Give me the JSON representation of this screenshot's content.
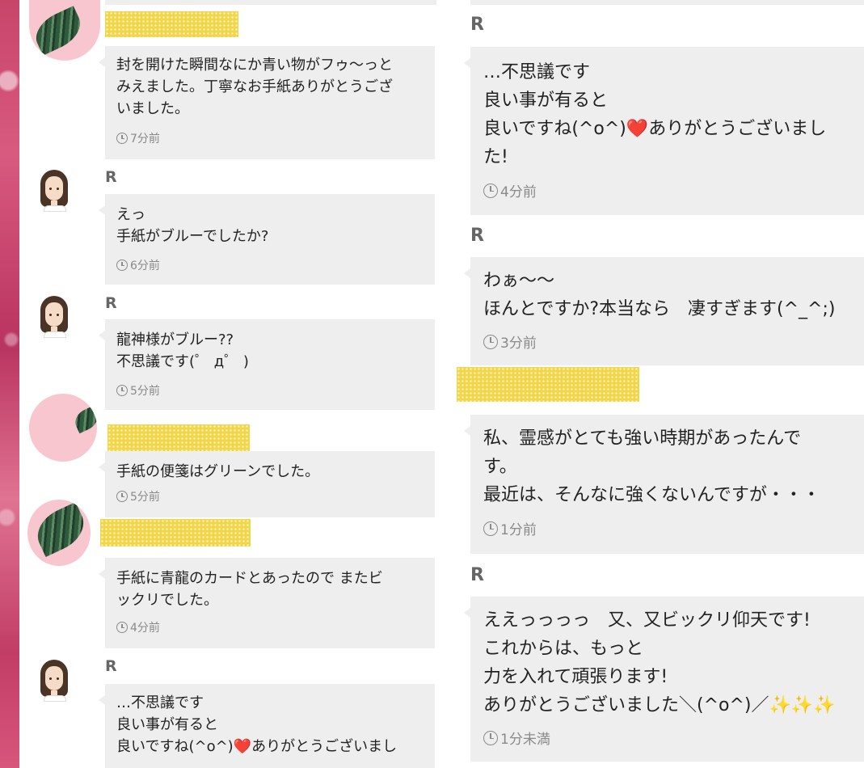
{
  "left_messages": [
    {
      "sender": "",
      "text": "封を開けた瞬間なにか青い物がフゥ〜っと\nみえました。丁寧なお手紙ありがとうござ\nいました。",
      "time": "7分前"
    },
    {
      "sender": "R",
      "text": "えっ\n手紙がブルーでしたか?",
      "time": "6分前"
    },
    {
      "sender": "R",
      "text": "龍神様がブルー??\n不思議です(゜ д゜ )",
      "time": "5分前"
    },
    {
      "sender": "",
      "text": "手紙の便箋はグリーンでした。",
      "time": "5分前"
    },
    {
      "sender": "",
      "text": "手紙に青龍のカードとあったので またビ\nックリでした。",
      "time": "4分前"
    },
    {
      "sender": "R",
      "text": "…不思議です\n良い事が有ると\n良いですね(^o^)❤️ありがとうございまし",
      "time": ""
    }
  ],
  "right_messages": [
    {
      "sender": "R",
      "text": "…不思議です\n良い事が有ると\n良いですね(^o^)❤️ありがとうございまし\nた!",
      "time": "4分前"
    },
    {
      "sender": "R",
      "text": "わぁ〜〜\nほんとですか?本当なら　凄すぎます(^_^;)",
      "time": "3分前"
    },
    {
      "sender": "",
      "text": "私、霊感がとても強い時期があったんで\nす。\n最近は、そんなに強くないんですが・・・",
      "time": "1分前"
    },
    {
      "sender": "R",
      "text": "ええっっっっ　又、又ビックリ仰天です!\nこれからは、もっと\n力を入れて頑張ります!\nありがとうございました＼(^o^)／✨✨✨",
      "time": "1分未満"
    }
  ],
  "icons": {
    "clock": "clock-icon",
    "avatar_leaf": "leaf-avatar",
    "avatar_girl": "girl-avatar"
  },
  "colors": {
    "bubble": "#eeeeee",
    "name_mask": "#f2d64a",
    "side_strip": "#c8456a"
  }
}
